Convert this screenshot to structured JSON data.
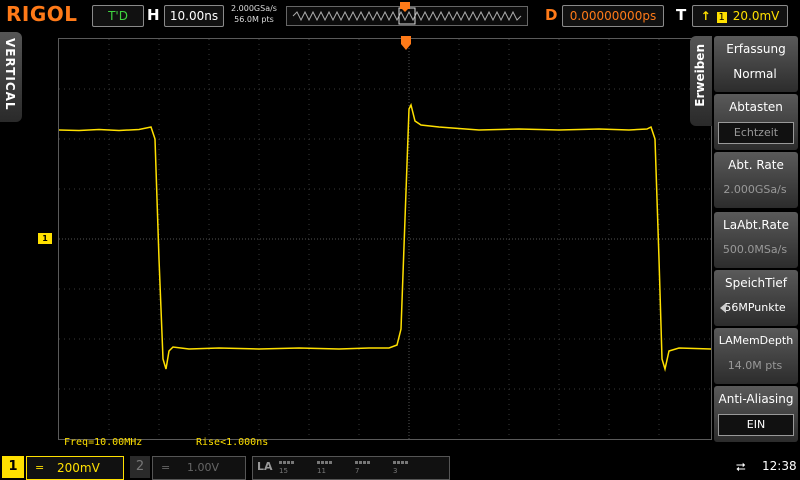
{
  "brand": "RIGOL",
  "top": {
    "run_status": "T'D",
    "h_label": "H",
    "timebase": "10.00ns",
    "sample_rate": "2.000GSa/s",
    "memory_points": "56.0M pts",
    "d_label": "D",
    "delay": "0.00000000ps",
    "t_label": "T",
    "trigger_level": "20.0mV",
    "trigger_icon": "rising-edge-icon",
    "trigger_channel": "1"
  },
  "left_tab": "VERTICAL",
  "measurements": {
    "freq": "Freq=10.00MHz",
    "rise": "Rise<1.000ns"
  },
  "menu": {
    "tab": "Erweiben",
    "items": [
      {
        "title": "Erfassung",
        "value": "Normal"
      },
      {
        "title": "Abtasten",
        "value": "Echtzeit"
      },
      {
        "title": "Abt. Rate",
        "value": "2.000GSa/s"
      },
      {
        "title": "LaAbt.Rate",
        "value": "500.0MSa/s"
      },
      {
        "title": "SpeichTief",
        "value": "56MPunkte"
      },
      {
        "title": "LAMemDepth",
        "value": "14.0M pts"
      },
      {
        "title": "Anti-Aliasing",
        "value": "EIN"
      }
    ]
  },
  "bottom": {
    "ch1_number": "1",
    "ch1_coupling": "=",
    "ch1_scale": "200mV",
    "ch2_number": "2",
    "ch2_coupling": "=",
    "ch2_scale": "1.00V",
    "la_label": "LA",
    "la_channels": [
      "15",
      "11",
      "7",
      "3"
    ],
    "time": "12:38"
  },
  "colors": {
    "ch1": "#ffe000",
    "accent": "#ff7a18",
    "run_status": "#3fd43f"
  }
}
